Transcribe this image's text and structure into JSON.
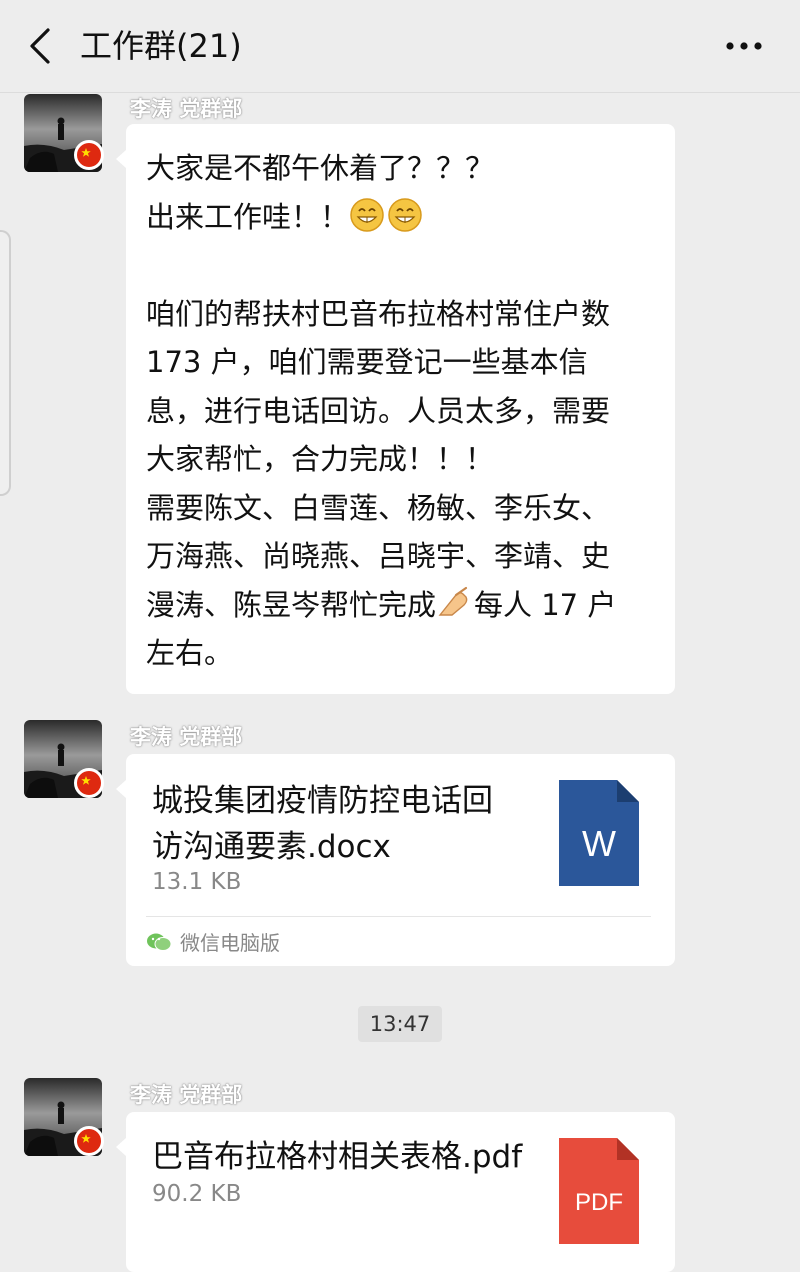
{
  "header": {
    "title": "工作群(21)",
    "back_icon": "back-arrow-icon",
    "more_icon": "more-dots-icon"
  },
  "messages": [
    {
      "sender": "李涛 党群部",
      "type": "text",
      "lines": {
        "line1": "大家是不都午休着了？？？",
        "line2": "出来工作哇！！",
        "line2_emoji": "grinning-face-icon",
        "line3": "",
        "line4": "咱们的帮扶村巴音布拉格村常住户数",
        "line5": "173 户，咱们需要登记一些基本信",
        "line6": "息，进行电话回访。人员太多，需要",
        "line7": "大家帮忙，合力完成！！！",
        "line8": "需要陈文、白雪莲、杨敏、李乐女、",
        "line9": "万海燕、尚晓燕、吕晓宇、李靖、史",
        "line10a": "漫涛、陈昱岑帮忙完成",
        "line10_emoji": "pointing-hand-icon",
        "line10b": "每人 17 户",
        "line11": "左右。"
      }
    },
    {
      "sender": "李涛 党群部",
      "type": "file",
      "file_name_line1": "城投集团疫情防控电话回",
      "file_name_line2": "访沟通要素.docx",
      "file_size": "13.1 KB",
      "file_icon_letter": "W",
      "file_icon_color": "#2b579a",
      "source": "微信电脑版"
    },
    {
      "sender": "李涛 党群部",
      "type": "file",
      "file_name_line1": "巴音布拉格村相关表格.pdf",
      "file_size": "90.2 KB",
      "file_icon_letter": "PDF",
      "file_icon_color": "#e74c3c"
    }
  ],
  "timestamp": "13:47"
}
